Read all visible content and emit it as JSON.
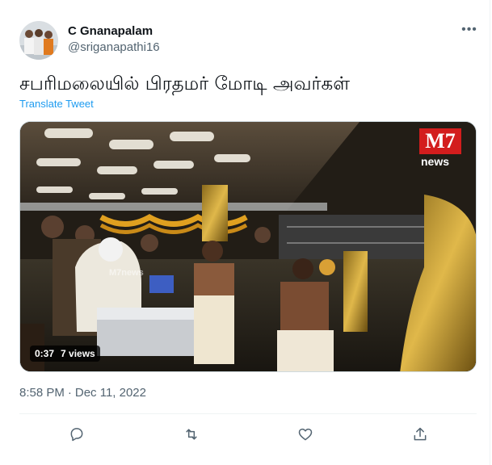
{
  "author": {
    "name": "C Gnanapalam",
    "handle": "@sriganapathi16",
    "avatar_icon": "user-group-photo"
  },
  "tweet": {
    "text": "சபரிமலையில் பிரதமர் மோடி அவர்கள்",
    "translate_label": "Translate Tweet",
    "time": "8:58 PM",
    "separator": "·",
    "date": "Dec 11, 2022"
  },
  "media": {
    "duration": "0:37",
    "views": "7 views",
    "watermark_main": "M7",
    "watermark_sub": "news",
    "overlay_watermark": "M7news"
  },
  "actions": {
    "reply_icon": "reply-icon",
    "retweet_icon": "retweet-icon",
    "like_icon": "like-icon",
    "share_icon": "share-icon"
  },
  "colors": {
    "accent": "#1d9bf0",
    "secondary_text": "#536471",
    "primary_text": "#0f1419",
    "logo_red": "#d31d1d"
  }
}
